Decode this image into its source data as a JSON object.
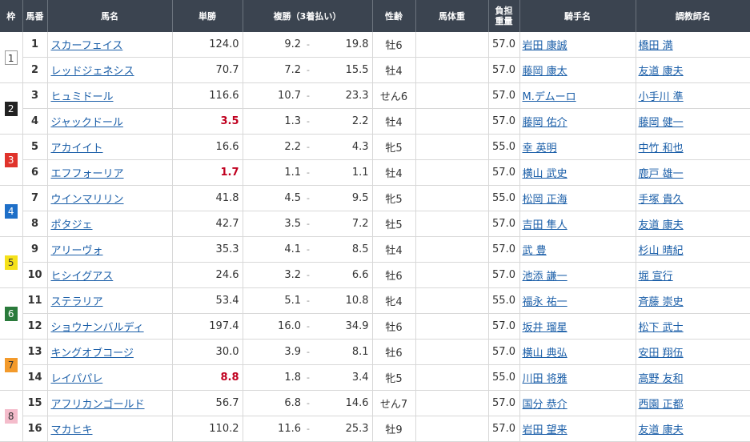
{
  "headers": {
    "waku": "枠",
    "umaban": "馬番",
    "name": "馬名",
    "win": "単勝",
    "place": "複勝（3着払い）",
    "sexage": "性齢",
    "weight": "馬体重",
    "burden_l1": "負担",
    "burden_l2": "重量",
    "jockey": "騎手名",
    "trainer": "調教師名"
  },
  "colors": {
    "header_bg": "#3b4450",
    "link": "#1a5ea8",
    "popular": "#c0001f",
    "waku": [
      "#ffffff",
      "#222222",
      "#e0332b",
      "#1e6fc8",
      "#f5e11a",
      "#2a7a3b",
      "#f39a2b",
      "#f4bccb"
    ]
  },
  "rows": [
    {
      "waku": "1",
      "umaban": "1",
      "name": "スカーフェイス",
      "win": "124.0",
      "plo": "9.2",
      "phi": "19.8",
      "sexage": "牡6",
      "weight": "",
      "burden": "57.0",
      "jockey": "岩田 康誠",
      "trainer": "橋田 満",
      "popular": false
    },
    {
      "waku": "",
      "umaban": "2",
      "name": "レッドジェネシス",
      "win": "70.7",
      "plo": "7.2",
      "phi": "15.5",
      "sexage": "牡4",
      "weight": "",
      "burden": "57.0",
      "jockey": "藤岡 康太",
      "trainer": "友道 康夫",
      "popular": false
    },
    {
      "waku": "2",
      "umaban": "3",
      "name": "ヒュミドール",
      "win": "116.6",
      "plo": "10.7",
      "phi": "23.3",
      "sexage": "せん6",
      "weight": "",
      "burden": "57.0",
      "jockey": "M.デムーロ",
      "trainer": "小手川 準",
      "popular": false
    },
    {
      "waku": "",
      "umaban": "4",
      "name": "ジャックドール",
      "win": "3.5",
      "plo": "1.3",
      "phi": "2.2",
      "sexage": "牡4",
      "weight": "",
      "burden": "57.0",
      "jockey": "藤岡 佑介",
      "trainer": "藤岡 健一",
      "popular": true
    },
    {
      "waku": "3",
      "umaban": "5",
      "name": "アカイイト",
      "win": "16.6",
      "plo": "2.2",
      "phi": "4.3",
      "sexage": "牝5",
      "weight": "",
      "burden": "55.0",
      "jockey": "幸 英明",
      "trainer": "中竹 和也",
      "popular": false
    },
    {
      "waku": "",
      "umaban": "6",
      "name": "エフフォーリア",
      "win": "1.7",
      "plo": "1.1",
      "phi": "1.1",
      "sexage": "牡4",
      "weight": "",
      "burden": "57.0",
      "jockey": "横山 武史",
      "trainer": "鹿戸 雄一",
      "popular": true
    },
    {
      "waku": "4",
      "umaban": "7",
      "name": "ウインマリリン",
      "win": "41.8",
      "plo": "4.5",
      "phi": "9.5",
      "sexage": "牝5",
      "weight": "",
      "burden": "55.0",
      "jockey": "松岡 正海",
      "trainer": "手塚 貴久",
      "popular": false
    },
    {
      "waku": "",
      "umaban": "8",
      "name": "ポタジェ",
      "win": "42.7",
      "plo": "3.5",
      "phi": "7.2",
      "sexage": "牡5",
      "weight": "",
      "burden": "57.0",
      "jockey": "吉田 隼人",
      "trainer": "友道 康夫",
      "popular": false
    },
    {
      "waku": "5",
      "umaban": "9",
      "name": "アリーヴォ",
      "win": "35.3",
      "plo": "4.1",
      "phi": "8.5",
      "sexage": "牡4",
      "weight": "",
      "burden": "57.0",
      "jockey": "武 豊",
      "trainer": "杉山 晴紀",
      "popular": false
    },
    {
      "waku": "",
      "umaban": "10",
      "name": "ヒシイグアス",
      "win": "24.6",
      "plo": "3.2",
      "phi": "6.6",
      "sexage": "牡6",
      "weight": "",
      "burden": "57.0",
      "jockey": "池添 謙一",
      "trainer": "堀 宣行",
      "popular": false
    },
    {
      "waku": "6",
      "umaban": "11",
      "name": "ステラリア",
      "win": "53.4",
      "plo": "5.1",
      "phi": "10.8",
      "sexage": "牝4",
      "weight": "",
      "burden": "55.0",
      "jockey": "福永 祐一",
      "trainer": "斉藤 崇史",
      "popular": false
    },
    {
      "waku": "",
      "umaban": "12",
      "name": "ショウナンバルディ",
      "win": "197.4",
      "plo": "16.0",
      "phi": "34.9",
      "sexage": "牡6",
      "weight": "",
      "burden": "57.0",
      "jockey": "坂井 瑠星",
      "trainer": "松下 武士",
      "popular": false
    },
    {
      "waku": "7",
      "umaban": "13",
      "name": "キングオブコージ",
      "win": "30.0",
      "plo": "3.9",
      "phi": "8.1",
      "sexage": "牡6",
      "weight": "",
      "burden": "57.0",
      "jockey": "横山 典弘",
      "trainer": "安田 翔伍",
      "popular": false
    },
    {
      "waku": "",
      "umaban": "14",
      "name": "レイパパレ",
      "win": "8.8",
      "plo": "1.8",
      "phi": "3.4",
      "sexage": "牝5",
      "weight": "",
      "burden": "55.0",
      "jockey": "川田 将雅",
      "trainer": "高野 友和",
      "popular": true
    },
    {
      "waku": "8",
      "umaban": "15",
      "name": "アフリカンゴールド",
      "win": "56.7",
      "plo": "6.8",
      "phi": "14.6",
      "sexage": "せん7",
      "weight": "",
      "burden": "57.0",
      "jockey": "国分 恭介",
      "trainer": "西園 正都",
      "popular": false
    },
    {
      "waku": "",
      "umaban": "16",
      "name": "マカヒキ",
      "win": "110.2",
      "plo": "11.6",
      "phi": "25.3",
      "sexage": "牡9",
      "weight": "",
      "burden": "57.0",
      "jockey": "岩田 望来",
      "trainer": "友道 康夫",
      "popular": false
    }
  ]
}
